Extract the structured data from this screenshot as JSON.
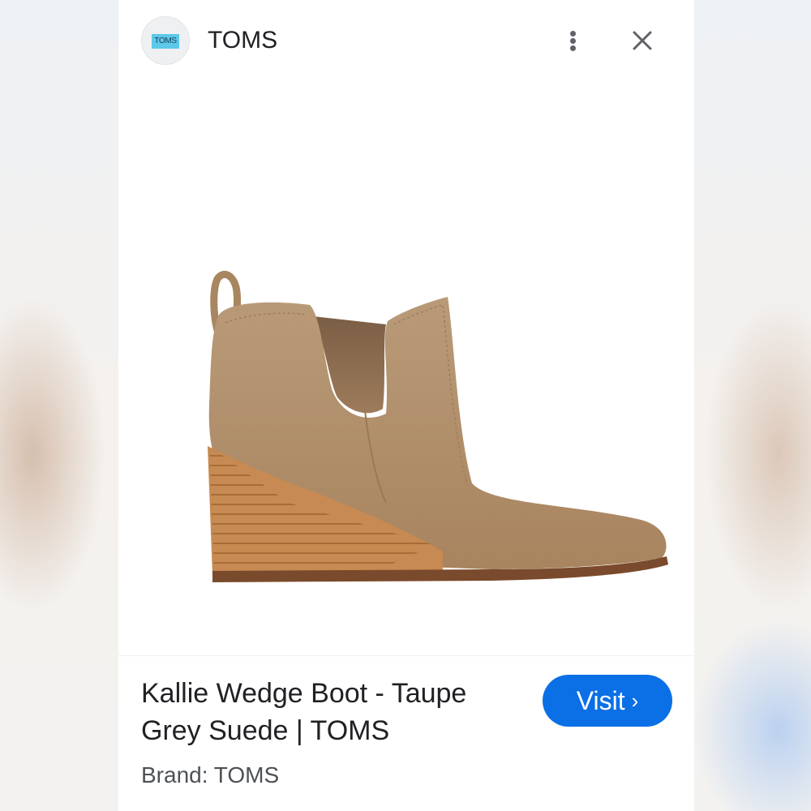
{
  "header": {
    "logo_text": "TOMS",
    "site_name": "TOMS"
  },
  "product": {
    "image_alt": "Kallie Wedge Boot - Taupe Grey Suede",
    "title": "Kallie Wedge Boot - Taupe Grey Suede | TOMS",
    "brand_label": "Brand: TOMS"
  },
  "actions": {
    "visit_label": "Visit",
    "visit_chevron": "›"
  },
  "icons": {
    "menu": "more-vert-icon",
    "close": "close-icon",
    "chevron": "chevron-right-icon"
  },
  "colors": {
    "accent": "#0b6fe6",
    "logo_box": "#5cc8ea",
    "suede": "#b6946f",
    "wedge": "#c98d55"
  }
}
